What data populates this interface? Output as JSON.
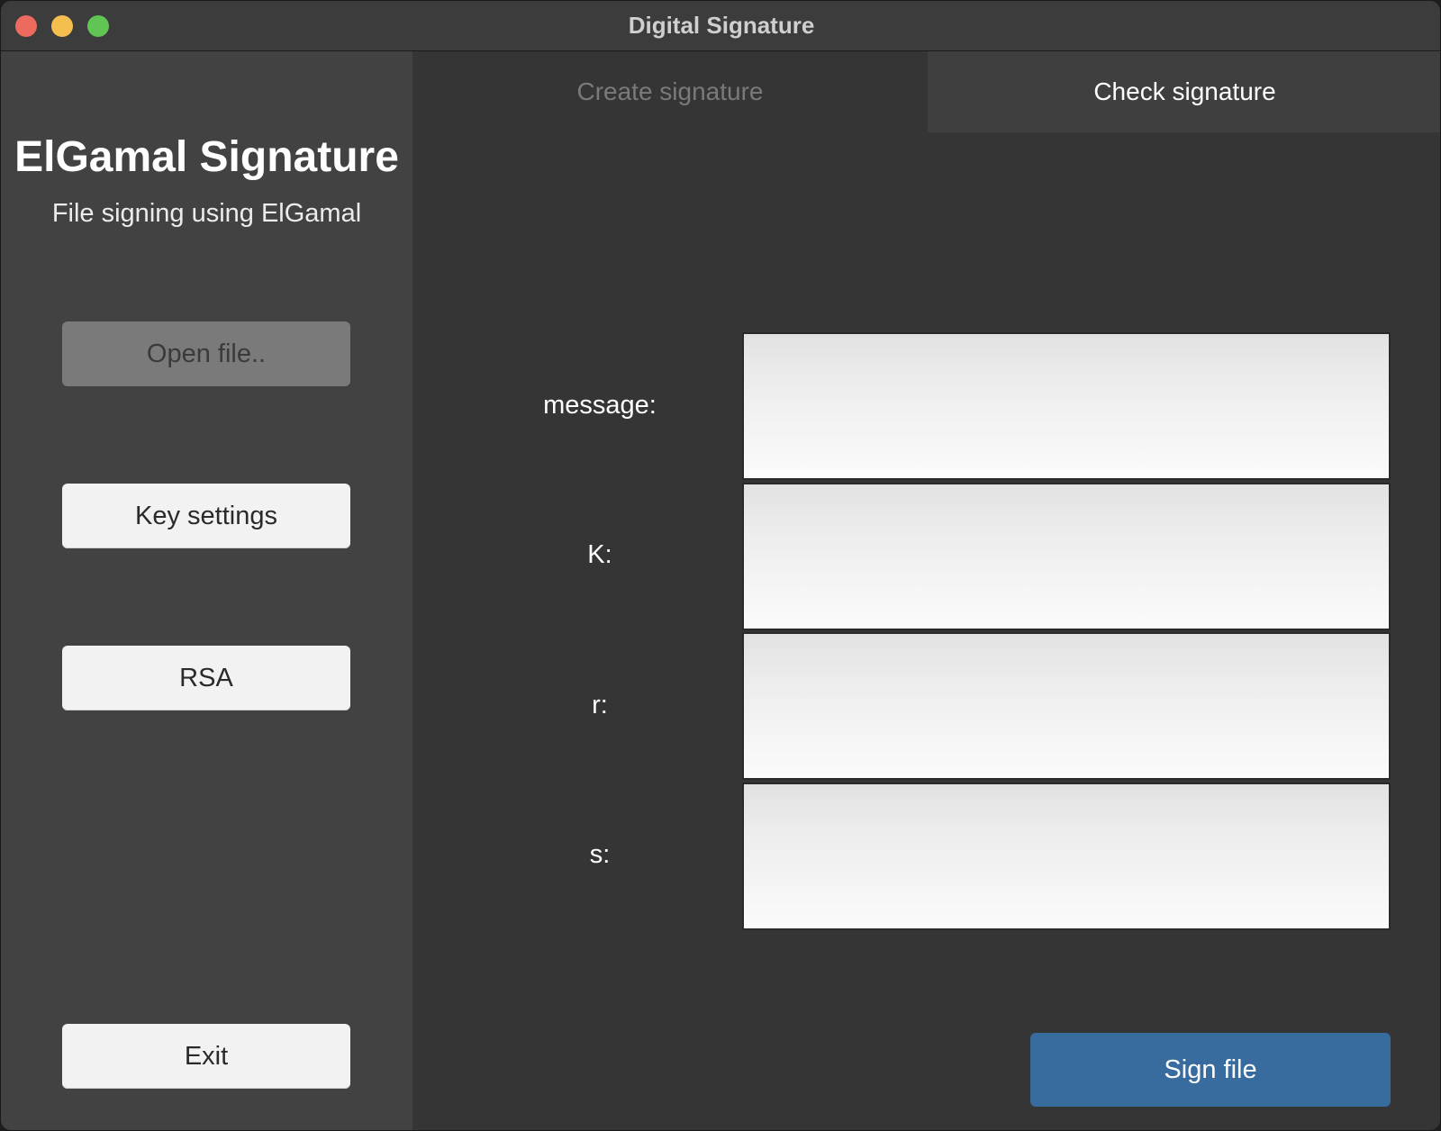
{
  "window": {
    "title": "Digital Signature"
  },
  "sidebar": {
    "title": "ElGamal Signature",
    "subtitle": "File signing using ElGamal",
    "buttons": {
      "open_file": "Open file..",
      "key_settings": "Key settings",
      "rsa": "RSA",
      "exit": "Exit"
    }
  },
  "tabs": {
    "create": "Create signature",
    "check": "Check signature",
    "active": "Check signature"
  },
  "form": {
    "message_label": "message:",
    "k_label": "K:",
    "r_label": "r:",
    "s_label": "s:",
    "message_value": "",
    "k_value": "",
    "r_value": "",
    "s_value": ""
  },
  "actions": {
    "sign_file": "Sign file"
  },
  "colors": {
    "accent": "#386b9e",
    "sidebar_bg": "#424242",
    "main_bg": "#353535",
    "disabled_button": "#7a7a7a",
    "close": "#ed6a5e",
    "minimize": "#f5bf4f",
    "maximize": "#61c554"
  }
}
